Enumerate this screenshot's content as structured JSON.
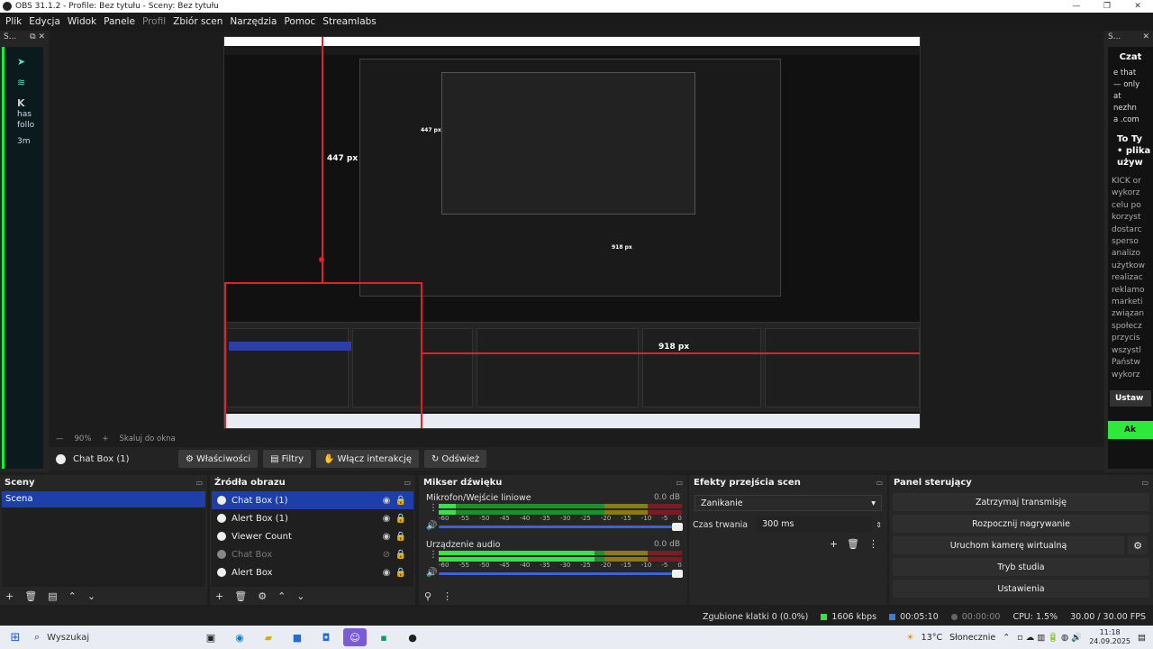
{
  "window": {
    "title": "OBS 31.1.2 - Profile: Bez tytułu - Sceny: Bez tytułu",
    "min": "—",
    "max": "❐",
    "close": "✕"
  },
  "menu": [
    "Plik",
    "Edycja",
    "Widok",
    "Panele",
    "Profil",
    "Zbiór scen",
    "Narzędzia",
    "Pomoc",
    "Streamlabs"
  ],
  "left_dock": {
    "title": "S...",
    "line1": "has",
    "line2": "follo",
    "line3": "3m"
  },
  "right_dock": {
    "title": "S...",
    "chat_title": "Czat",
    "chat_lines": [
      "e that",
      "— only",
      "at",
      "nezhn",
      "a .com"
    ],
    "bold_lines": [
      "To Ty",
      "• plika",
      "używ"
    ],
    "grey_lines": [
      "KICK or",
      "wykorz",
      "celu po",
      "korzyst",
      "dostarc",
      "sperso",
      "analizo",
      "użytkow",
      "realizac",
      "reklamo",
      "marketi",
      "związan",
      "społecz",
      "przycis",
      "wszystl",
      "Państw",
      "wykorz"
    ],
    "btn_dark": "Ustaw",
    "btn_green": "Ak"
  },
  "preview": {
    "measure_v": "447 px",
    "measure_h": "918 px",
    "nested_measure_v": "447 px",
    "nested_measure_h": "918 px"
  },
  "zoom": {
    "percent": "90%",
    "fit": "Skaluj do okna"
  },
  "source_toolbar": {
    "current": "Chat Box (1)",
    "buttons": [
      "Właściwości",
      "Filtry",
      "Włącz interakcję",
      "Odśwież"
    ]
  },
  "scenes": {
    "title": "Sceny",
    "items": [
      "Scena"
    ]
  },
  "sources": {
    "title": "Źródła obrazu",
    "items": [
      "Chat Box (1)",
      "Alert Box (1)",
      "Viewer Count",
      "Chat Box",
      "Alert Box"
    ]
  },
  "mixer": {
    "title": "Mikser dźwięku",
    "channels": [
      {
        "name": "Mikrofon/Wejście liniowe",
        "db": "0.0 dB",
        "level": 0.07
      },
      {
        "name": "Urządzenie audio",
        "db": "0.0 dB",
        "level": 0.64
      }
    ],
    "ticks": [
      "-60",
      "-55",
      "-50",
      "-45",
      "-40",
      "-35",
      "-30",
      "-25",
      "-20",
      "-15",
      "-10",
      "-5",
      "0"
    ]
  },
  "transitions": {
    "title": "Efekty przejścia scen",
    "selected": "Zanikanie",
    "duration_label": "Czas trwania",
    "duration_value": "300 ms"
  },
  "controls": {
    "title": "Panel sterujący",
    "buttons": [
      "Zatrzymaj transmisję",
      "Rozpocznij nagrywanie",
      "Uruchom kamerę wirtualną",
      "Tryb studia",
      "Ustawienia"
    ]
  },
  "status": {
    "dropped": "Zgubione klatki 0 (0.0%)",
    "bitrate": "1606 kbps",
    "stream_time": "00:05:10",
    "rec_time": "00:00:00",
    "cpu": "CPU: 1.5%",
    "fps": "30.00 / 30.00 FPS"
  },
  "taskbar": {
    "search": "Wyszukaj",
    "weather": "13°C",
    "weather_text": "Słonecznie",
    "time": "11:18",
    "date": "24.09.2025"
  },
  "colors": {
    "accent": "#1f3fa8",
    "stream_green": "#2ee83a",
    "measure_red": "#e0202a"
  }
}
